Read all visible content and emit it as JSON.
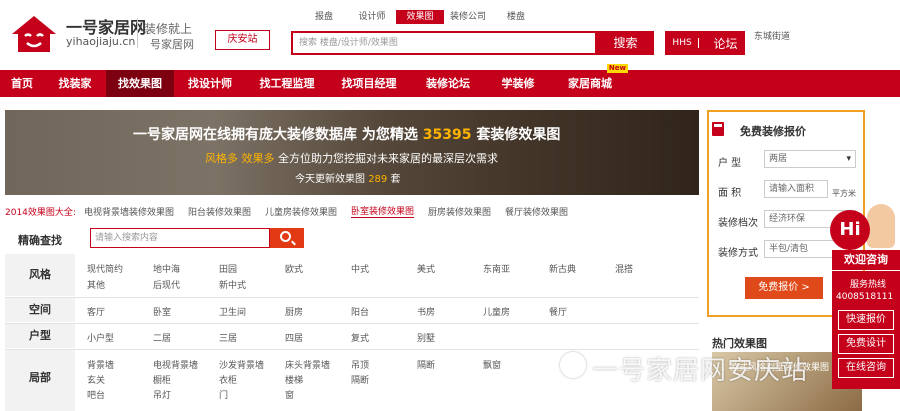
{
  "header": {
    "logo_title": "一号家居网",
    "logo_domain": "yihaojiaju.cn",
    "slogan_line1": "装修就上",
    "slogan_line2": "号家居网",
    "city_button": "庆安站",
    "search_tabs": [
      "报盘",
      "设计师",
      "效果图",
      "装修公司",
      "楼盘"
    ],
    "search_tab_active": 2,
    "search_placeholder": "搜索 楼盘/设计师/效果图",
    "search_button": "搜索",
    "bbs_prefix": "HHS",
    "bbs_label": "论坛",
    "top_right": "东城街道"
  },
  "nav": {
    "items": [
      {
        "label": "首页",
        "width": 62
      },
      {
        "label": "找装家",
        "width": 54
      },
      {
        "label": "找效果图",
        "width": 66
      },
      {
        "label": "找设计师",
        "width": 66
      },
      {
        "label": "找工程监理",
        "width": 80
      },
      {
        "label": "找项目经理",
        "width": 80
      },
      {
        "label": "装修论坛",
        "width": 70
      },
      {
        "label": "学装修",
        "width": 60
      },
      {
        "label": "家居商城",
        "width": 70
      }
    ],
    "active": 2,
    "new_badge": "New"
  },
  "banner": {
    "h1_prefix": "一号家居网在线拥有庞大装修数据库 为您精选",
    "h1_number": "35395",
    "h1_suffix": "套装修效果图",
    "h2_highlight": "风格多 效果多",
    "h2_text": "全方位助力您挖掘对未来家居的最深层次需求",
    "h3_prefix": "今天更新效果图",
    "h3_number": "289",
    "h3_suffix": "套"
  },
  "quick_links": {
    "lead": "2014效果图大全:",
    "items": [
      "电视背景墙装修效果图",
      "阳台装修效果图",
      "儿童房装修效果图",
      "卧室装修效果图",
      "厨房装修效果图",
      "餐厅装修效果图"
    ],
    "active": 3
  },
  "filter": {
    "label": "精确查找",
    "placeholder": "请输入搜索内容",
    "rows": [
      {
        "head": "风格",
        "items": [
          "现代简约",
          "地中海",
          "田园",
          "欧式",
          "中式",
          "美式",
          "东南亚",
          "新古典",
          "混搭",
          "其他",
          "后现代",
          "新中式"
        ]
      },
      {
        "head": "空间",
        "items": [
          "客厅",
          "卧室",
          "卫生间",
          "厨房",
          "阳台",
          "书房",
          "儿童房",
          "餐厅"
        ]
      },
      {
        "head": "户型",
        "items": [
          "小户型",
          "二居",
          "三居",
          "四居",
          "复式",
          "别墅"
        ]
      },
      {
        "head": "局部",
        "items": [
          "背景墙",
          "电视背景墙",
          "沙发背景墙",
          "床头背景墙",
          "吊顶",
          "隔断",
          "飘窗",
          "玄关",
          "橱柜",
          "衣柜",
          "楼梯",
          "隔断",
          "吧台",
          "吊灯",
          "门",
          "窗"
        ]
      }
    ]
  },
  "quote": {
    "title": "免费装修报价",
    "fields": [
      {
        "label": "户  型",
        "value": "两居",
        "type": "select"
      },
      {
        "label": "面  积",
        "value": "请输入面积",
        "type": "input"
      },
      {
        "label": "装修档次",
        "value": "经济环保",
        "type": "select"
      },
      {
        "label": "装修方式",
        "value": "半包/清包",
        "type": "select"
      }
    ],
    "unit": "平方米",
    "button": "免费报价 >"
  },
  "hot": {
    "title": "热门效果图",
    "caption": "欧式风格别墅装修效果图"
  },
  "consult": {
    "hi": "Hi",
    "bar": "欢迎咨询",
    "hotline_label": "服务热线",
    "phone": "4008518111",
    "buttons": [
      "快速报价",
      "免费设计",
      "在线咨询"
    ]
  },
  "watermark": "一号家居网安庆站"
}
